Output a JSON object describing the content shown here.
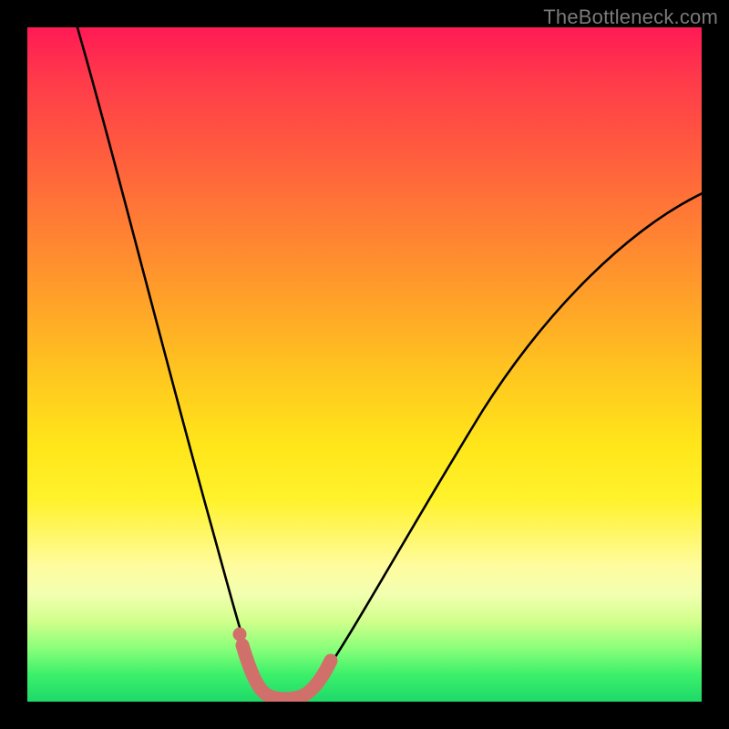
{
  "watermark": "TheBottleneck.com",
  "chart_data": {
    "type": "line",
    "title": "",
    "xlabel": "",
    "ylabel": "",
    "xlim": [
      0,
      100
    ],
    "ylim": [
      0,
      100
    ],
    "grid": false,
    "series": [
      {
        "name": "bottleneck-curve",
        "x": [
          5,
          8,
          11,
          14,
          17,
          20,
          23,
          26,
          29,
          31,
          33,
          35,
          37,
          40,
          43,
          46,
          50,
          55,
          60,
          66,
          72,
          79,
          86,
          93,
          100
        ],
        "y": [
          100,
          90,
          80,
          70,
          60,
          50,
          40,
          30,
          20,
          12,
          6,
          2,
          1,
          1,
          2,
          6,
          12,
          20,
          28,
          36,
          44,
          52,
          58,
          63,
          67
        ]
      }
    ],
    "highlight": {
      "name": "optimal-range",
      "x": [
        31,
        33,
        35,
        37,
        39,
        41,
        43
      ],
      "y": [
        6,
        2,
        1,
        1,
        1,
        2,
        6
      ]
    },
    "colors": {
      "curve": "#000000",
      "highlight": "#d1706b",
      "gradient_top": "#ff1a55",
      "gradient_bottom": "#1ed969"
    }
  }
}
